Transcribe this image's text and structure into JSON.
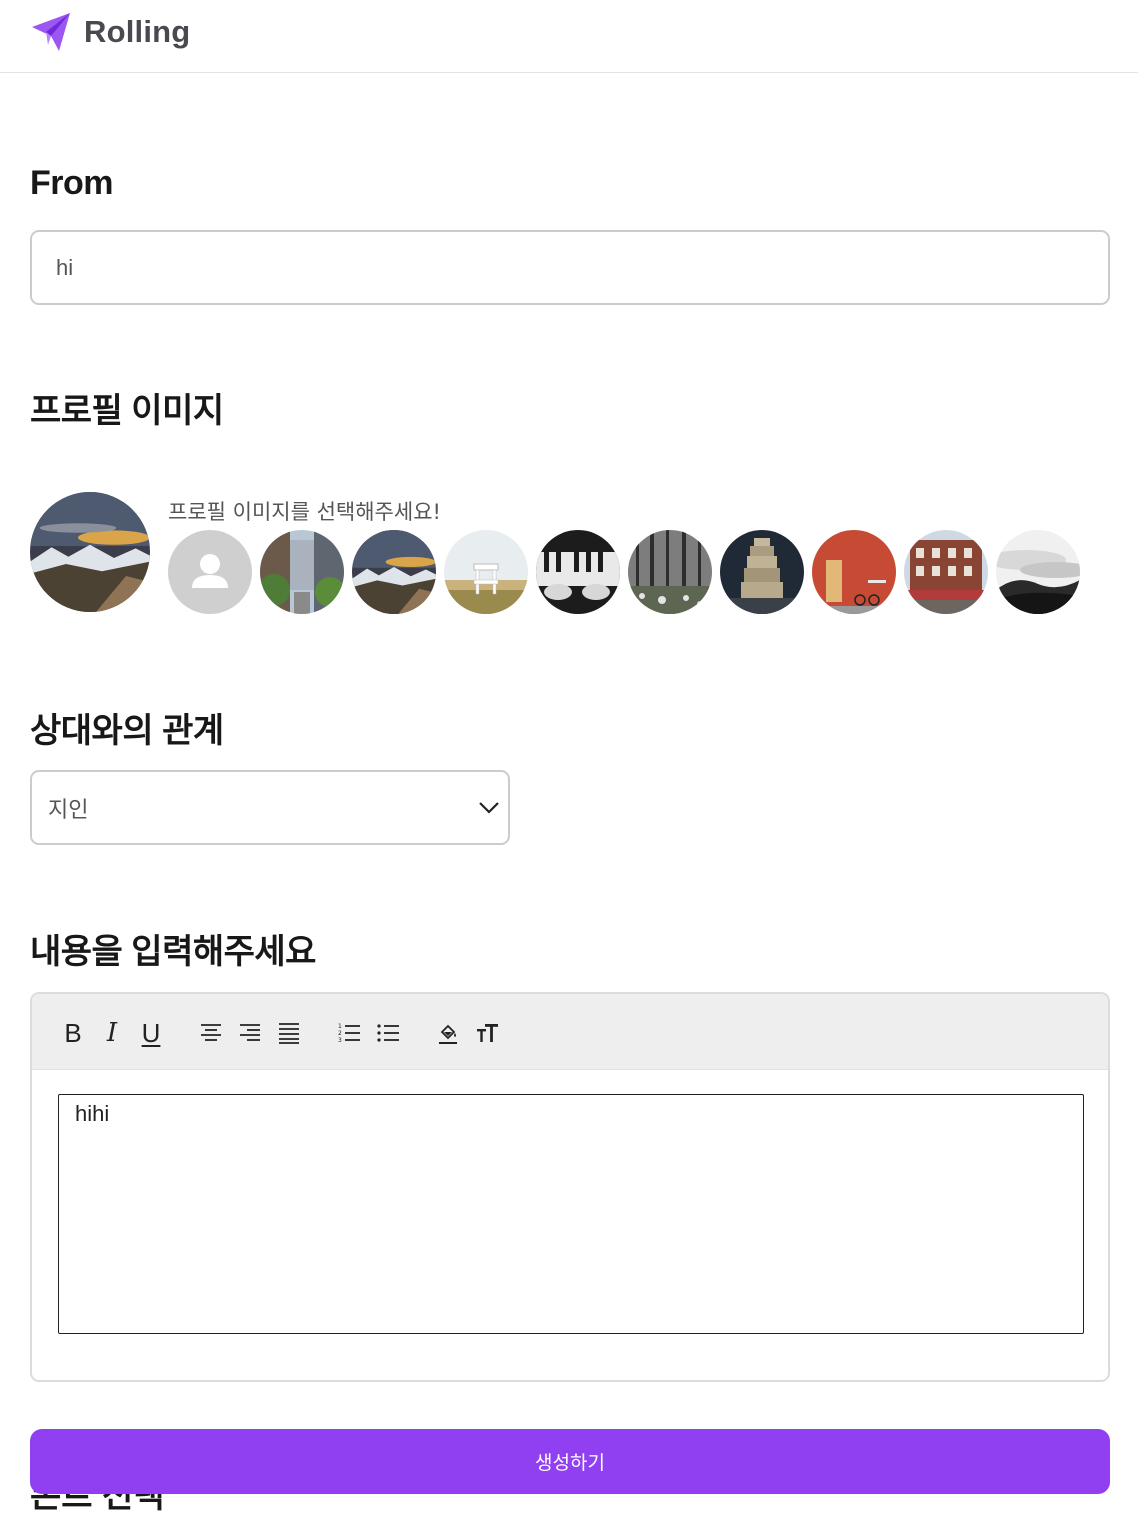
{
  "app": {
    "name": "Rolling",
    "accent": "#9040f0"
  },
  "from": {
    "title": "From",
    "value": "hi"
  },
  "profile": {
    "title": "프로필 이미지",
    "hint": "프로필 이미지를 선택해주세요!",
    "selected": "mountain-sunset-icon",
    "options": [
      "default-user-icon",
      "city-street-icon",
      "mountain-sunset-icon",
      "beach-chair-icon",
      "piano-keys-icon",
      "forest-icon",
      "stone-tower-icon",
      "red-door-icon",
      "brick-building-icon",
      "cloud-mountain-icon"
    ]
  },
  "relation": {
    "title": "상대와의 관계",
    "value": "지인"
  },
  "content": {
    "title": "내용을 입력해주세요",
    "text": "hihi",
    "toolbar": {
      "bold": "B",
      "italic": "I",
      "underline": "U",
      "font_size": "TT"
    }
  },
  "font_section": {
    "title_partial": "폰트 선택"
  },
  "submit": {
    "label": "생성하기"
  }
}
